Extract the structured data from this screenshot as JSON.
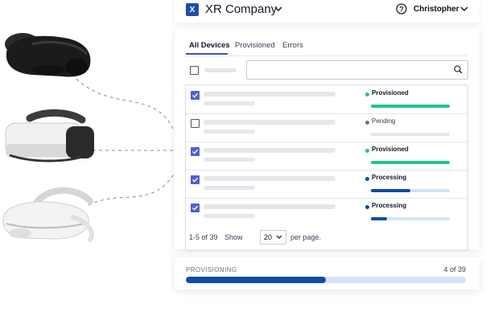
{
  "header": {
    "logo_letter": "X",
    "company": "XR Company",
    "user": "Christopher"
  },
  "tabs": [
    {
      "label": "All Devices",
      "active": true
    },
    {
      "label": "Provisioned",
      "active": false
    },
    {
      "label": "Errors",
      "active": false
    }
  ],
  "rows": [
    {
      "checked": true,
      "status": "Provisioned",
      "status_color": "#22c58b",
      "track_color": "#22c58b",
      "progress": 1.0
    },
    {
      "checked": false,
      "status": "Pending",
      "status_color": "#6b7280",
      "track_color": "#e5e7eb",
      "progress": 0.0
    },
    {
      "checked": true,
      "status": "Provisioned",
      "status_color": "#22c58b",
      "track_color": "#22c58b",
      "progress": 1.0
    },
    {
      "checked": true,
      "status": "Processing",
      "status_color": "#0f4aa8",
      "track_color": "#d4e4f7",
      "progress": 0.5
    },
    {
      "checked": true,
      "status": "Processing",
      "status_color": "#0f4aa8",
      "track_color": "#d4e4f7",
      "progress": 0.2
    }
  ],
  "footer": {
    "range": "1-5 of 39",
    "show_label": "Show",
    "per_page_value": "20",
    "per_page_suffix": "per page."
  },
  "provisioning": {
    "label": "PROVISIONING",
    "count": "4 of 39",
    "progress": 0.5
  },
  "colors": {
    "accent": "#3b4fc4",
    "brand": "#1e4fa8",
    "success": "#22c58b",
    "processing": "#0f4aa8"
  }
}
